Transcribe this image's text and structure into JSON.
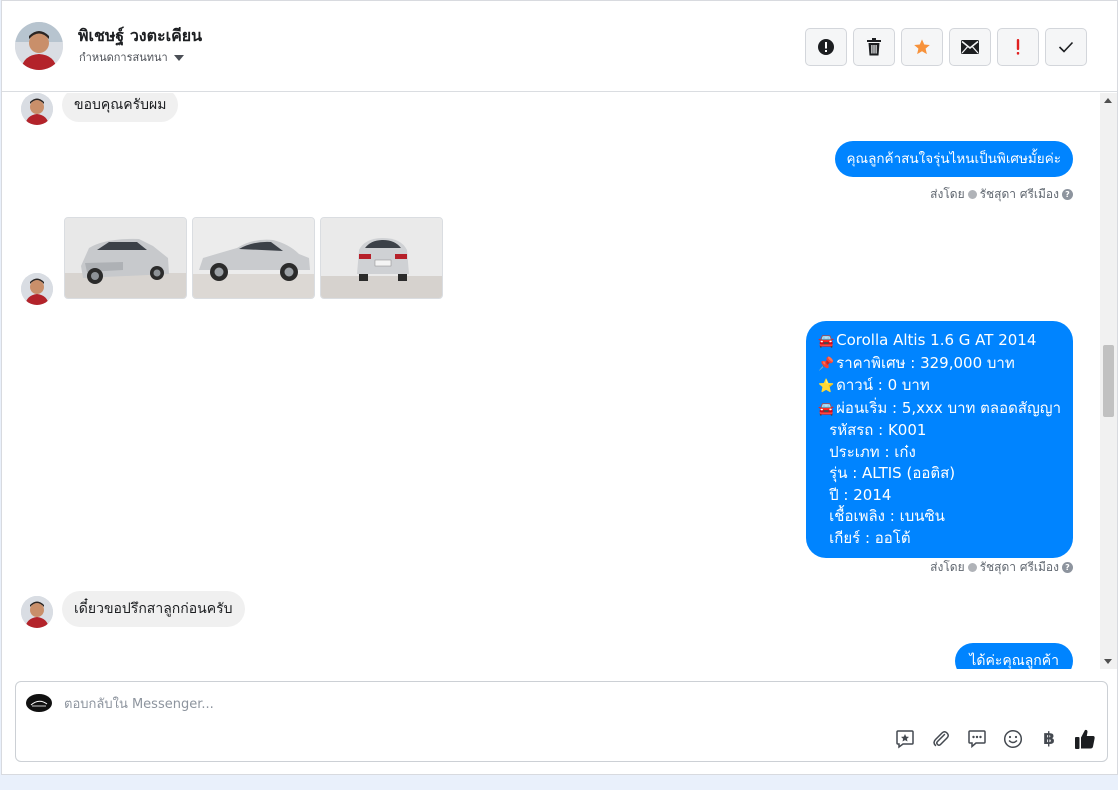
{
  "header": {
    "name": "พิเชษฐ์ วงตะเคียน",
    "subtitle": "กำหนดการสนทนา",
    "actions": [
      {
        "icon": "alert-circle-icon"
      },
      {
        "icon": "trash-icon"
      },
      {
        "icon": "star-icon",
        "color": "#f7923b"
      },
      {
        "icon": "mail-icon"
      },
      {
        "icon": "exclamation-icon",
        "color": "#e02020"
      },
      {
        "icon": "check-icon"
      }
    ]
  },
  "thread": {
    "msg1": "ขอบคุณครับผม",
    "msg2": "คุณลูกค้าสนใจรุ่นไหนเป็นพิเศษมั้ยค่ะ",
    "sent_prefix": "ส่งโดย",
    "sent_by": "รัชสุดา ศรีเมือง",
    "car_info": {
      "line1": "Corolla Altis 1.6 G  AT 2014",
      "line2": "ราคาพิเศษ : 329,000 บาท",
      "line3": "ดาวน์ : 0 บาท",
      "line4": "ผ่อนเริ่ม : 5,xxx บาท ตลอดสัญญา",
      "line5": "รหัสรถ : K001",
      "line6": "ประเภท : เก๋ง",
      "line7": "รุ่น : ALTIS (ออติส)",
      "line8": "ปี : 2014",
      "line9": "เชื้อเพลิง : เบนซิน",
      "line10": "เกียร์ : ออโต้"
    },
    "msg3": "เดี๋ยวขอปรึกสาลูกก่อนครับ",
    "msg4": "ได้ค่ะคุณลูกค้า"
  },
  "composer": {
    "placeholder": "ตอบกลับใน Messenger...",
    "baht_symbol": "฿"
  },
  "colors": {
    "outgoing_bubble": "#0084ff",
    "incoming_bubble": "#f0f0f0"
  }
}
